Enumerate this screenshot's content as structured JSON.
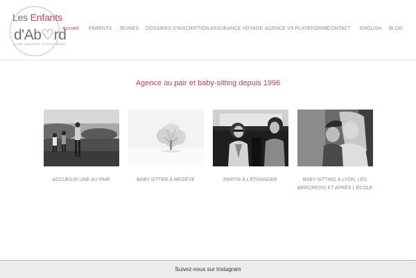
{
  "header": {
    "logo": {
      "line1_prefix": "Les ",
      "line1_accent": "Enfants",
      "line2": "d'Ab♡rd",
      "tagline": "AU PAIR · BABY-SITTING · ÉCOLE À L'ÉTRANGER"
    },
    "nav": [
      {
        "label": "Accueil",
        "active": true
      },
      {
        "label": "PARENTS"
      },
      {
        "label": "JEUNES"
      },
      {
        "label": "DOSSIERS D'INSCRIPTION"
      },
      {
        "label": "ASSURANCE VOYAGE"
      },
      {
        "label": "AGENCE vs PLATEFORME"
      },
      {
        "label": "CONTACT"
      },
      {
        "label": "ENGLISH"
      },
      {
        "label": "BLOG"
      }
    ]
  },
  "main": {
    "title": "Agence au pair et baby-sitting depuis 1996",
    "cards": [
      {
        "label_line1": "ACCUEILIR UNE AU PAIR",
        "label_line2": "",
        "image": "family-on-rocks-photo"
      },
      {
        "label_line1": "BABY-SITTER À MEGÈVE",
        "label_line2": "",
        "image": "snowy-tree-photo"
      },
      {
        "label_line1": "PARTIR À L'ÉTRANGER",
        "label_line2": "",
        "image": "two-girls-in-car-photo"
      },
      {
        "label_line1": "BABY-SITTING À LYON, LES",
        "label_line2": "MERCREDIS ET APRÈS L'ÉCOLE",
        "image": "girl-and-child-photo"
      }
    ]
  },
  "footer": {
    "text": "Suivez-nous sur Instagram"
  },
  "colors": {
    "accent": "#b5435f",
    "nav_text": "#8a8a8a",
    "footer_bg": "#ececec"
  }
}
